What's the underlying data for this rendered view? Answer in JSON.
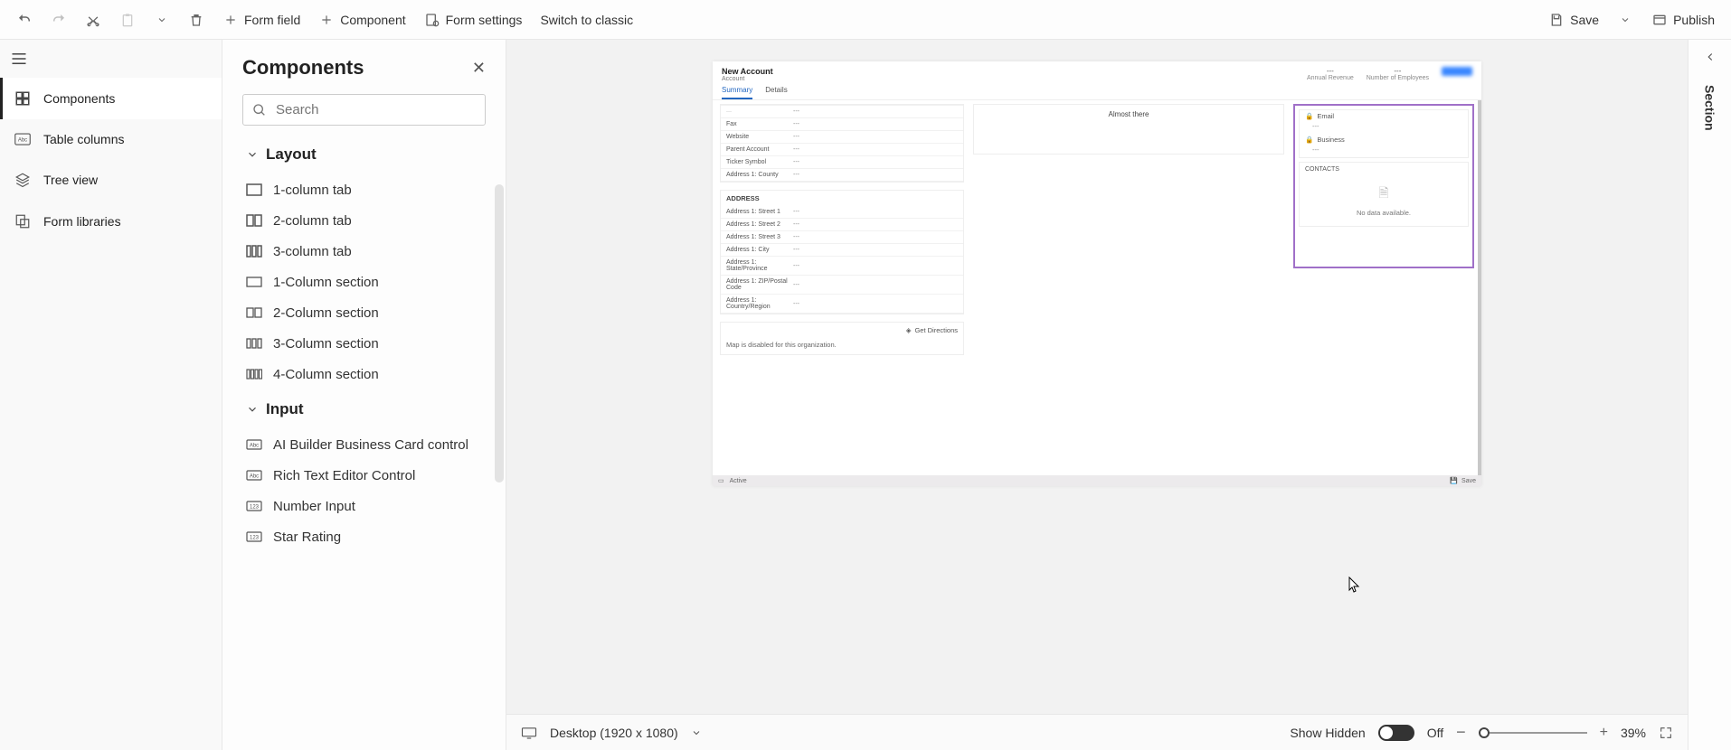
{
  "toolbar": {
    "form_field": "Form field",
    "component": "Component",
    "form_settings": "Form settings",
    "switch_classic": "Switch to classic",
    "save": "Save",
    "publish": "Publish"
  },
  "nav": {
    "components": "Components",
    "table_columns": "Table columns",
    "tree_view": "Tree view",
    "form_libraries": "Form libraries"
  },
  "panel": {
    "title": "Components",
    "search_placeholder": "Search",
    "groups": {
      "layout": {
        "title": "Layout",
        "items": [
          "1-column tab",
          "2-column tab",
          "3-column tab",
          "1-Column section",
          "2-Column section",
          "3-Column section",
          "4-Column section"
        ]
      },
      "input": {
        "title": "Input",
        "items": [
          "AI Builder Business Card control",
          "Rich Text Editor Control",
          "Number Input",
          "Star Rating"
        ]
      }
    }
  },
  "form": {
    "header": {
      "title": "New Account",
      "subtitle": "Account",
      "annual_revenue_label": "Annual Revenue",
      "num_employees_label": "Number of Employees",
      "dash": "---"
    },
    "tabs": {
      "summary": "Summary",
      "details": "Details"
    },
    "rows_upper": [
      {
        "k": "Fax",
        "v": "---"
      },
      {
        "k": "Website",
        "v": "---"
      },
      {
        "k": "Parent Account",
        "v": "---"
      },
      {
        "k": "Ticker Symbol",
        "v": "---"
      },
      {
        "k": "Address 1: County",
        "v": "---"
      }
    ],
    "address_title": "ADDRESS",
    "rows_address": [
      {
        "k": "Address 1: Street 1",
        "v": "---"
      },
      {
        "k": "Address 1: Street 2",
        "v": "---"
      },
      {
        "k": "Address 1: Street 3",
        "v": "---"
      },
      {
        "k": "Address 1: City",
        "v": "---"
      },
      {
        "k": "Address 1: State/Province",
        "v": "---"
      },
      {
        "k": "Address 1: ZIP/Postal Code",
        "v": "---"
      },
      {
        "k": "Address 1: Country/Region",
        "v": "---"
      }
    ],
    "almost_there": "Almost there",
    "get_directions": "Get Directions",
    "map_disabled": "Map is disabled for this organization.",
    "right": {
      "email_label": "Email",
      "business_label": "Business",
      "dash": "---",
      "contacts_title": "CONTACTS",
      "no_data": "No data available."
    },
    "status": {
      "active": "Active",
      "save": "Save"
    }
  },
  "footer": {
    "viewport": "Desktop (1920 x 1080)",
    "show_hidden": "Show Hidden",
    "toggle_state": "Off",
    "zoom": "39%"
  },
  "right_pane": {
    "label": "Section"
  }
}
